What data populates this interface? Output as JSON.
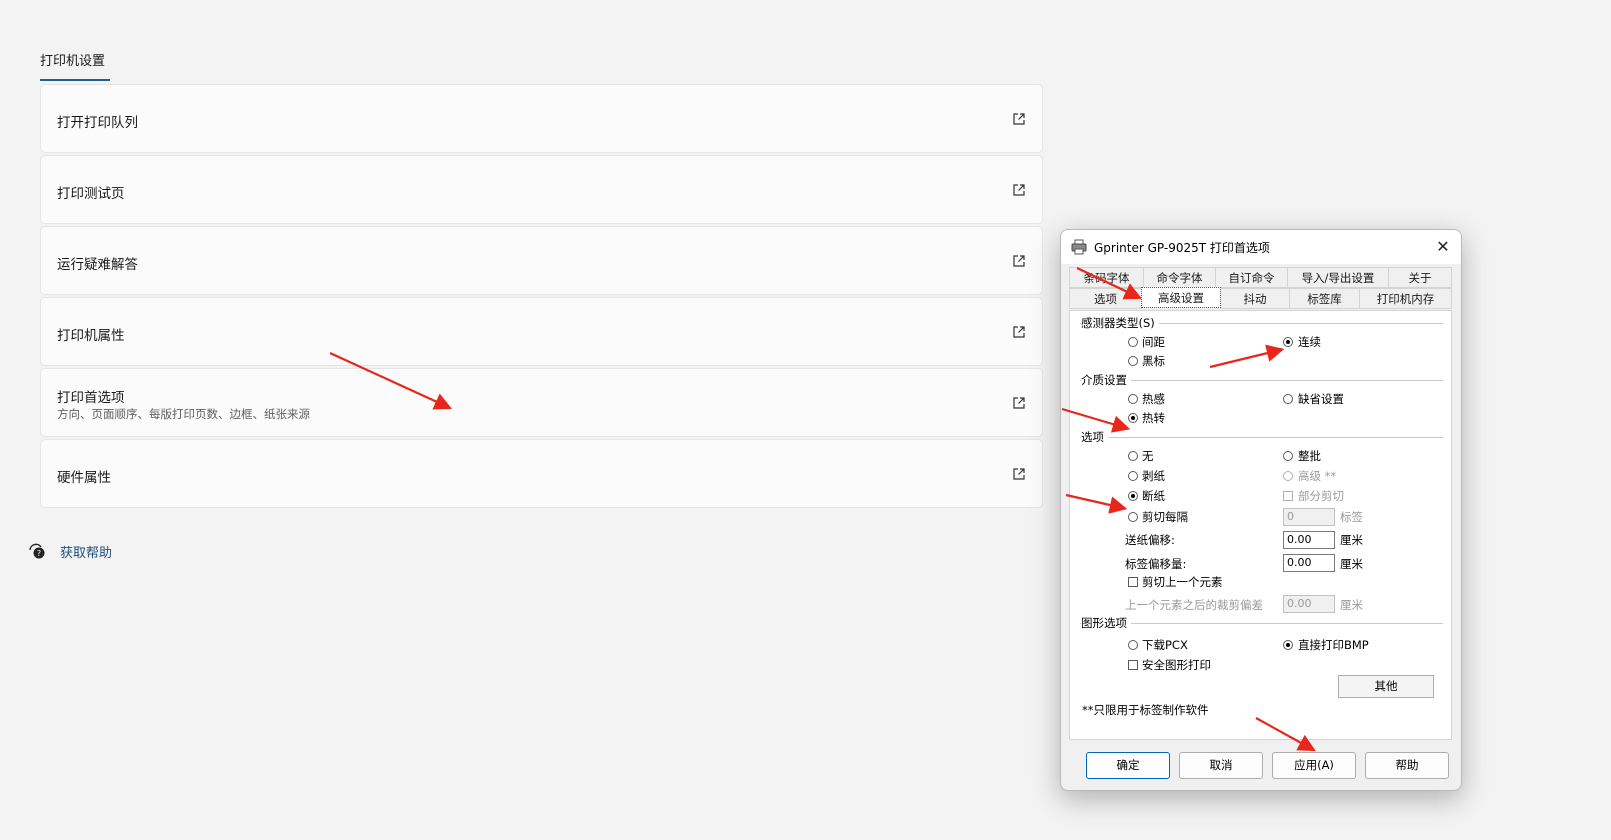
{
  "settings": {
    "section_title": "打印机设置",
    "cards": [
      {
        "title": "打开打印队列",
        "subtitle": ""
      },
      {
        "title": "打印测试页",
        "subtitle": ""
      },
      {
        "title": "运行疑难解答",
        "subtitle": ""
      },
      {
        "title": "打印机属性",
        "subtitle": ""
      },
      {
        "title": "打印首选项",
        "subtitle": "方向、页面顺序、每版打印页数、边框、纸张来源"
      },
      {
        "title": "硬件属性",
        "subtitle": ""
      }
    ],
    "help_link": "获取帮助"
  },
  "dialog": {
    "title": "Gprinter GP-9025T 打印首选项",
    "close": "✕",
    "tabs_row1": [
      "条码字体",
      "命令字体",
      "自订命令",
      "导入/导出设置",
      "关于"
    ],
    "tabs_row2": [
      "选项",
      "高级设置",
      "抖动",
      "标签库",
      "打印机内存"
    ],
    "active_tab": "高级设置",
    "sensor": {
      "label": "感测器类型(S)",
      "gap": "间距",
      "black_mark": "黑标",
      "continuous": "连续",
      "selected": "连续"
    },
    "media": {
      "label": "介质设置",
      "thermal": "热感",
      "thermal_transfer": "热转",
      "default": "缺省设置",
      "selected": "热转"
    },
    "options": {
      "label": "选项",
      "none": "无",
      "peel": "剥纸",
      "tear": "断纸",
      "cut_every": "剪切每隔",
      "batch": "整批",
      "advanced": "高级 **",
      "partial_cut": "部分剪切",
      "cut_every_value": "0",
      "cut_every_unit": "标签",
      "feed_offset_label": "送纸偏移:",
      "feed_offset_value": "0.00",
      "label_offset_label": "标签偏移量:",
      "label_offset_value": "0.00",
      "unit_cm": "厘米",
      "cut_prev": "剪切上一个元素",
      "after_prev_label": "上一个元素之后的裁剪偏差",
      "after_prev_value": "0.00",
      "selected": "断纸"
    },
    "graphics": {
      "label": "图形选项",
      "download_pcx": "下载PCX",
      "direct_bmp": "直接打印BMP",
      "safe_print": "安全图形打印",
      "other_button": "其他",
      "selected": "直接打印BMP"
    },
    "footnote": "**只限用于标签制作软件",
    "buttons": {
      "ok": "确定",
      "cancel": "取消",
      "apply": "应用(A)",
      "help": "帮助"
    }
  },
  "colors": {
    "accent_underline": "#1f5e8f",
    "link": "#1f4e79",
    "annotation_arrow": "#e8261c"
  }
}
